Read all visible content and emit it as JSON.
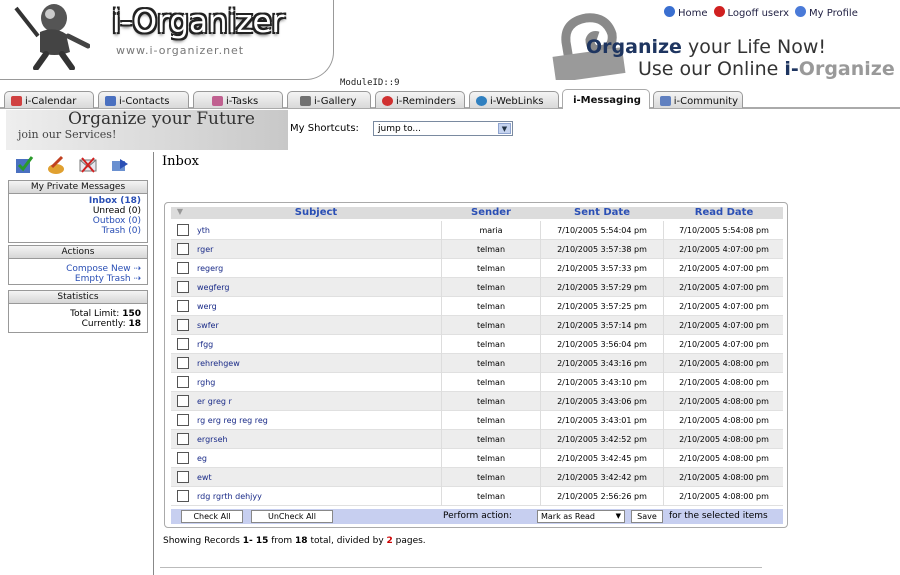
{
  "header": {
    "logo_text": "i-Organizer",
    "logo_url": "www.i-organizer.net",
    "module_id": "ModuleID::9",
    "links": [
      {
        "label": "Home",
        "icon": "home-icon",
        "color": "#3a6fd0"
      },
      {
        "label": "Logoff userx",
        "icon": "logoff-icon",
        "color": "#d02020"
      },
      {
        "label": "My Profile",
        "icon": "profile-icon",
        "color": "#4a7ad8"
      }
    ],
    "slogan_bold": "Organize",
    "slogan_rest": " your Life Now!",
    "slogan2_pre": "Use our Online ",
    "slogan2_bold": "i-",
    "slogan2_fade": "Organize"
  },
  "tabs": [
    {
      "label": "i-Calendar",
      "icon": "calendar-icon",
      "color": "#d04040"
    },
    {
      "label": "i-Contacts",
      "icon": "contacts-icon",
      "color": "#4a70c0"
    },
    {
      "label": "i-Tasks",
      "icon": "tasks-icon",
      "color": "#c06090"
    },
    {
      "label": "i-Gallery",
      "icon": "gallery-icon",
      "color": "#707070"
    },
    {
      "label": "i-Reminders",
      "icon": "reminders-icon",
      "color": "#d03030"
    },
    {
      "label": "i-WebLinks",
      "icon": "weblinks-icon",
      "color": "#3080c0"
    },
    {
      "label": "i-Messaging",
      "icon": "",
      "color": ""
    },
    {
      "label": "i-Community",
      "icon": "community-icon",
      "color": "#6080c0"
    }
  ],
  "promo": {
    "title": "Organize your Future",
    "subtitle": "join our Services!"
  },
  "shortcuts": {
    "label": "My Shortcuts:",
    "value": "jump to..."
  },
  "sidebar": {
    "messages_title": "My Private Messages",
    "inbox": "Inbox (18)",
    "unread": "Unread (0)",
    "outbox": "Outbox (0)",
    "trash": "Trash (0)",
    "actions_title": "Actions",
    "compose": "Compose New ⇢",
    "empty": "Empty Trash ⇢",
    "stats_title": "Statistics",
    "total_label": "Total Limit: ",
    "total_value": "150",
    "current_label": "Currently: ",
    "current_value": "18"
  },
  "inbox": {
    "title": "Inbox",
    "columns": [
      "Subject",
      "Sender",
      "Sent Date",
      "Read Date"
    ],
    "rows": [
      {
        "subject": "yth",
        "sender": "maria",
        "sent": "7/10/2005 5:54:04 pm",
        "read": "7/10/2005 5:54:08 pm"
      },
      {
        "subject": "rger",
        "sender": "telman",
        "sent": "2/10/2005 3:57:38 pm",
        "read": "2/10/2005 4:07:00 pm"
      },
      {
        "subject": "regerg",
        "sender": "telman",
        "sent": "2/10/2005 3:57:33 pm",
        "read": "2/10/2005 4:07:00 pm"
      },
      {
        "subject": "wegferg",
        "sender": "telman",
        "sent": "2/10/2005 3:57:29 pm",
        "read": "2/10/2005 4:07:00 pm"
      },
      {
        "subject": "werg",
        "sender": "telman",
        "sent": "2/10/2005 3:57:25 pm",
        "read": "2/10/2005 4:07:00 pm"
      },
      {
        "subject": "swfer",
        "sender": "telman",
        "sent": "2/10/2005 3:57:14 pm",
        "read": "2/10/2005 4:07:00 pm"
      },
      {
        "subject": "rfgg",
        "sender": "telman",
        "sent": "2/10/2005 3:56:04 pm",
        "read": "2/10/2005 4:07:00 pm"
      },
      {
        "subject": "rehrehgew",
        "sender": "telman",
        "sent": "2/10/2005 3:43:16 pm",
        "read": "2/10/2005 4:08:00 pm"
      },
      {
        "subject": "rghg",
        "sender": "telman",
        "sent": "2/10/2005 3:43:10 pm",
        "read": "2/10/2005 4:08:00 pm"
      },
      {
        "subject": "er greg r",
        "sender": "telman",
        "sent": "2/10/2005 3:43:06 pm",
        "read": "2/10/2005 4:08:00 pm"
      },
      {
        "subject": "rg erg reg reg reg",
        "sender": "telman",
        "sent": "2/10/2005 3:43:01 pm",
        "read": "2/10/2005 4:08:00 pm"
      },
      {
        "subject": "ergrseh",
        "sender": "telman",
        "sent": "2/10/2005 3:42:52 pm",
        "read": "2/10/2005 4:08:00 pm"
      },
      {
        "subject": "eg",
        "sender": "telman",
        "sent": "2/10/2005 3:42:45 pm",
        "read": "2/10/2005 4:08:00 pm"
      },
      {
        "subject": "ewt",
        "sender": "telman",
        "sent": "2/10/2005 3:42:42 pm",
        "read": "2/10/2005 4:08:00 pm"
      },
      {
        "subject": "rdg rgrth dehjyy",
        "sender": "telman",
        "sent": "2/10/2005 2:56:26 pm",
        "read": "2/10/2005 4:08:00 pm"
      }
    ],
    "check_all": "Check All",
    "uncheck_all": "UnCheck All",
    "perform_label": "Perform action:",
    "action_value": "Mark as Read",
    "save": "Save",
    "selected_suffix": "for the selected items"
  },
  "records": {
    "pre": "Showing Records ",
    "range": "1- 15",
    "from": " from ",
    "total": "18",
    "mid": " total, divided by ",
    "pages": "2",
    "post": " pages."
  }
}
